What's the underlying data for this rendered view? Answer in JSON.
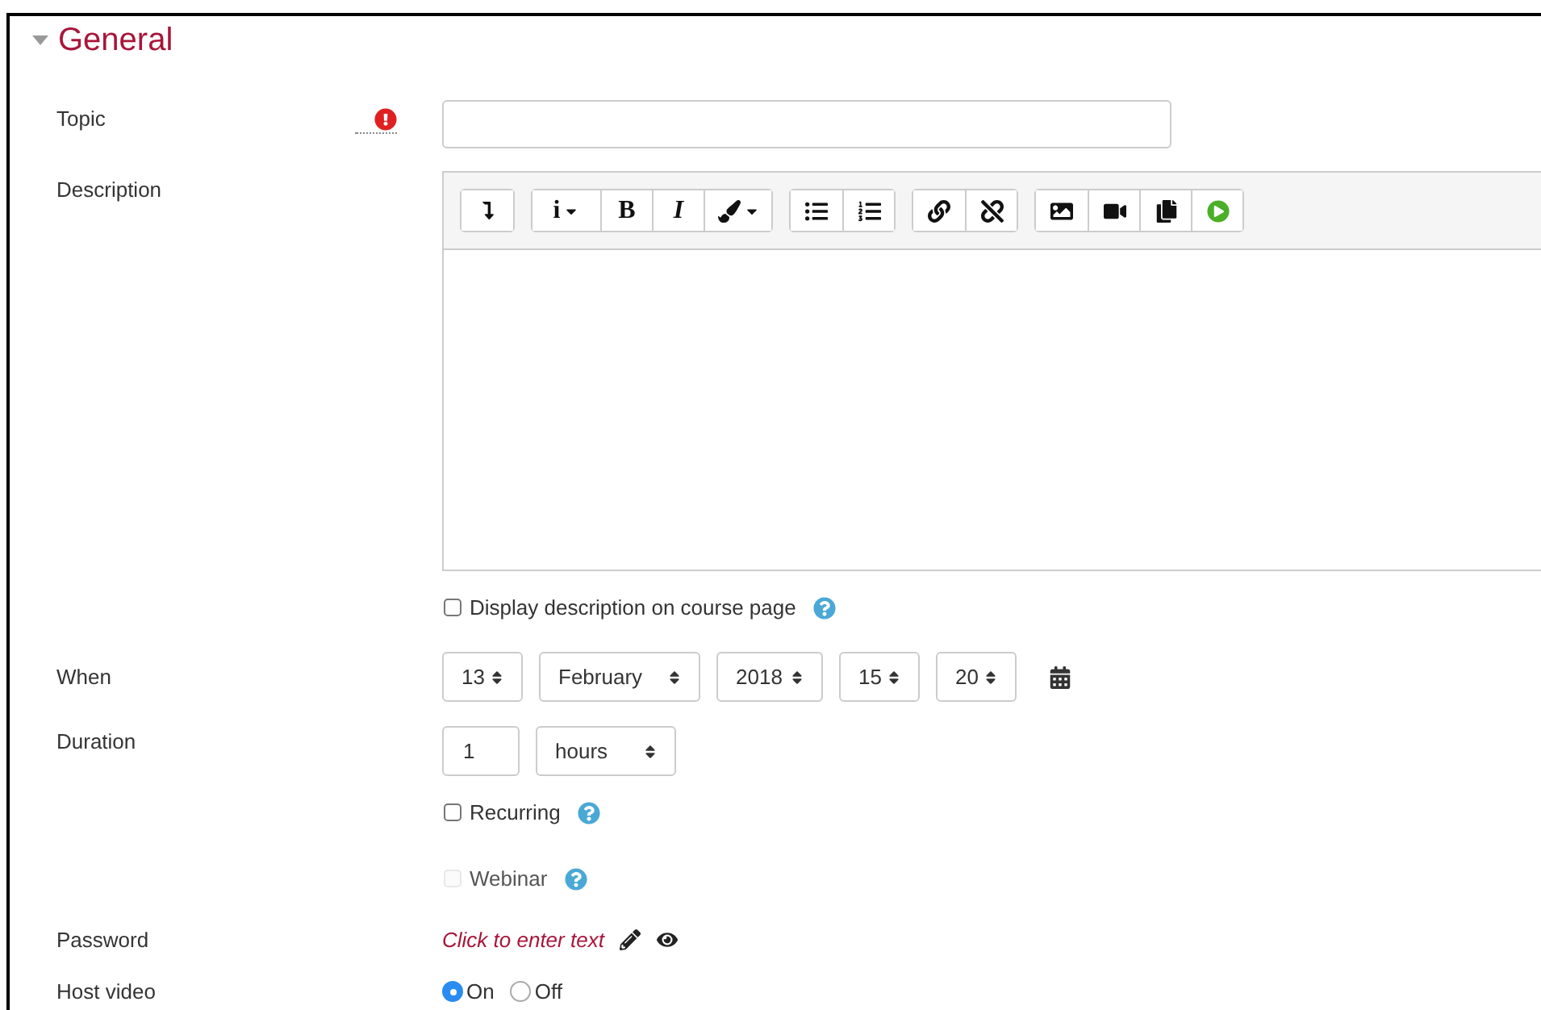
{
  "section": {
    "title": "General",
    "expanded": true
  },
  "topic": {
    "label": "Topic",
    "required": true
  },
  "description": {
    "label": "Description",
    "toolbar": [
      [
        {
          "kind": "more"
        }
      ],
      [
        {
          "kind": "text",
          "label": "i",
          "dropdown": true
        },
        {
          "kind": "text",
          "label": "B"
        },
        {
          "kind": "italic",
          "label": "I"
        },
        {
          "kind": "brush",
          "dropdown": true
        }
      ],
      [
        {
          "kind": "bullets"
        },
        {
          "kind": "numbers"
        }
      ],
      [
        {
          "kind": "link"
        },
        {
          "kind": "unlink"
        }
      ],
      [
        {
          "kind": "image"
        },
        {
          "kind": "video"
        },
        {
          "kind": "copy"
        },
        {
          "kind": "play"
        }
      ]
    ]
  },
  "display_description": {
    "label": "Display description on course page",
    "checked": false,
    "disabled": false
  },
  "when": {
    "label": "When",
    "selects": [
      "13",
      "February",
      "2018",
      "15",
      "20"
    ]
  },
  "duration": {
    "label": "Duration",
    "value": "1",
    "unit": "hours"
  },
  "options": [
    {
      "label": "Recurring",
      "checked": false,
      "disabled": false
    },
    {
      "label": "Webinar",
      "checked": false,
      "disabled": true
    }
  ],
  "password": {
    "label": "Password",
    "link": "Click to enter text"
  },
  "host_video": {
    "label": "Host video",
    "choices": [
      {
        "label": "On",
        "selected": true
      },
      {
        "label": "Off",
        "selected": false
      }
    ]
  }
}
